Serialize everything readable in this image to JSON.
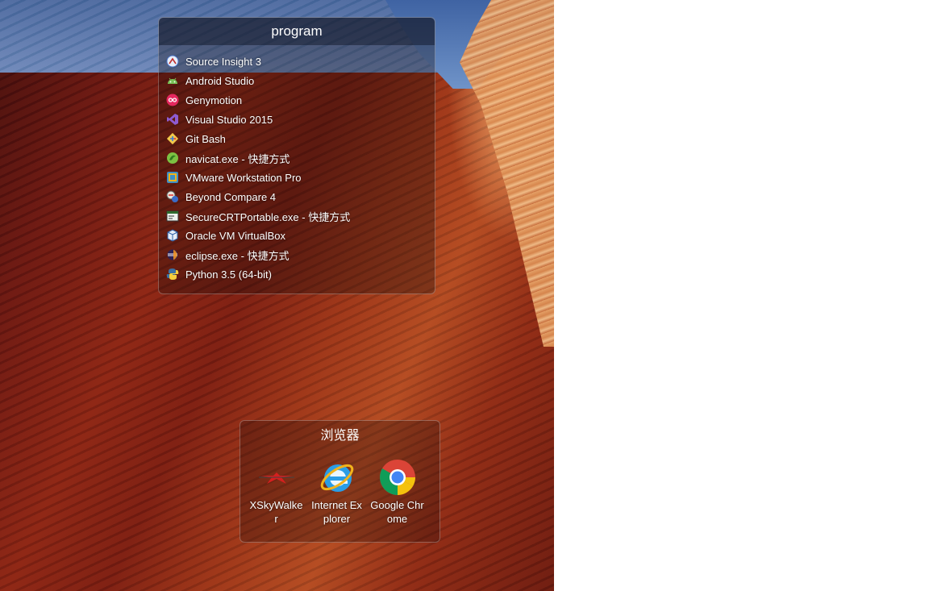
{
  "fences": {
    "program": {
      "title": "program",
      "items": [
        {
          "label": "Source Insight 3",
          "icon": "source-insight-icon"
        },
        {
          "label": "Android Studio",
          "icon": "android-studio-icon"
        },
        {
          "label": "Genymotion",
          "icon": "genymotion-icon"
        },
        {
          "label": "Visual Studio 2015",
          "icon": "visual-studio-icon"
        },
        {
          "label": "Git Bash",
          "icon": "git-bash-icon"
        },
        {
          "label": "navicat.exe - 快捷方式",
          "icon": "navicat-icon"
        },
        {
          "label": "VMware Workstation Pro",
          "icon": "vmware-icon"
        },
        {
          "label": "Beyond Compare 4",
          "icon": "beyond-compare-icon"
        },
        {
          "label": "SecureCRTPortable.exe - 快捷方式",
          "icon": "securecrt-icon"
        },
        {
          "label": "Oracle VM VirtualBox",
          "icon": "virtualbox-icon"
        },
        {
          "label": "eclipse.exe - 快捷方式",
          "icon": "eclipse-icon"
        },
        {
          "label": "Python 3.5 (64-bit)",
          "icon": "python-icon"
        }
      ]
    },
    "browser": {
      "title": "浏览器",
      "items": [
        {
          "label": "XSkyWalker",
          "icon": "xskywalker-icon"
        },
        {
          "label": "Internet Explorer",
          "icon": "internet-explorer-icon"
        },
        {
          "label": "Google Chrome",
          "icon": "google-chrome-icon"
        }
      ]
    }
  }
}
